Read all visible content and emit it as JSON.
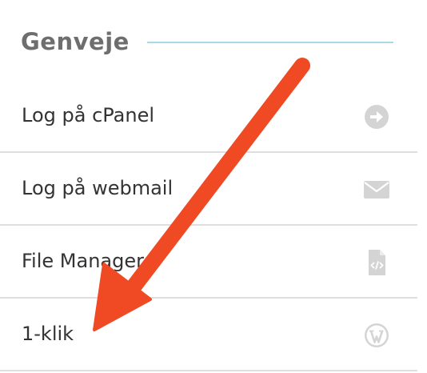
{
  "section": {
    "title": "Genveje"
  },
  "shortcuts": [
    {
      "label": "Log på cPanel",
      "icon": "arrow-right-circle-icon"
    },
    {
      "label": "Log på webmail",
      "icon": "envelope-icon"
    },
    {
      "label": "File Manager",
      "icon": "code-file-icon"
    },
    {
      "label": "1-klik",
      "icon": "wordpress-icon"
    }
  ],
  "colors": {
    "heading": "#6e6e6e",
    "accent_line": "#a9d9e6",
    "icon": "#d4d4d4",
    "divider": "#dedede",
    "annotation_arrow": "#f04a25"
  }
}
